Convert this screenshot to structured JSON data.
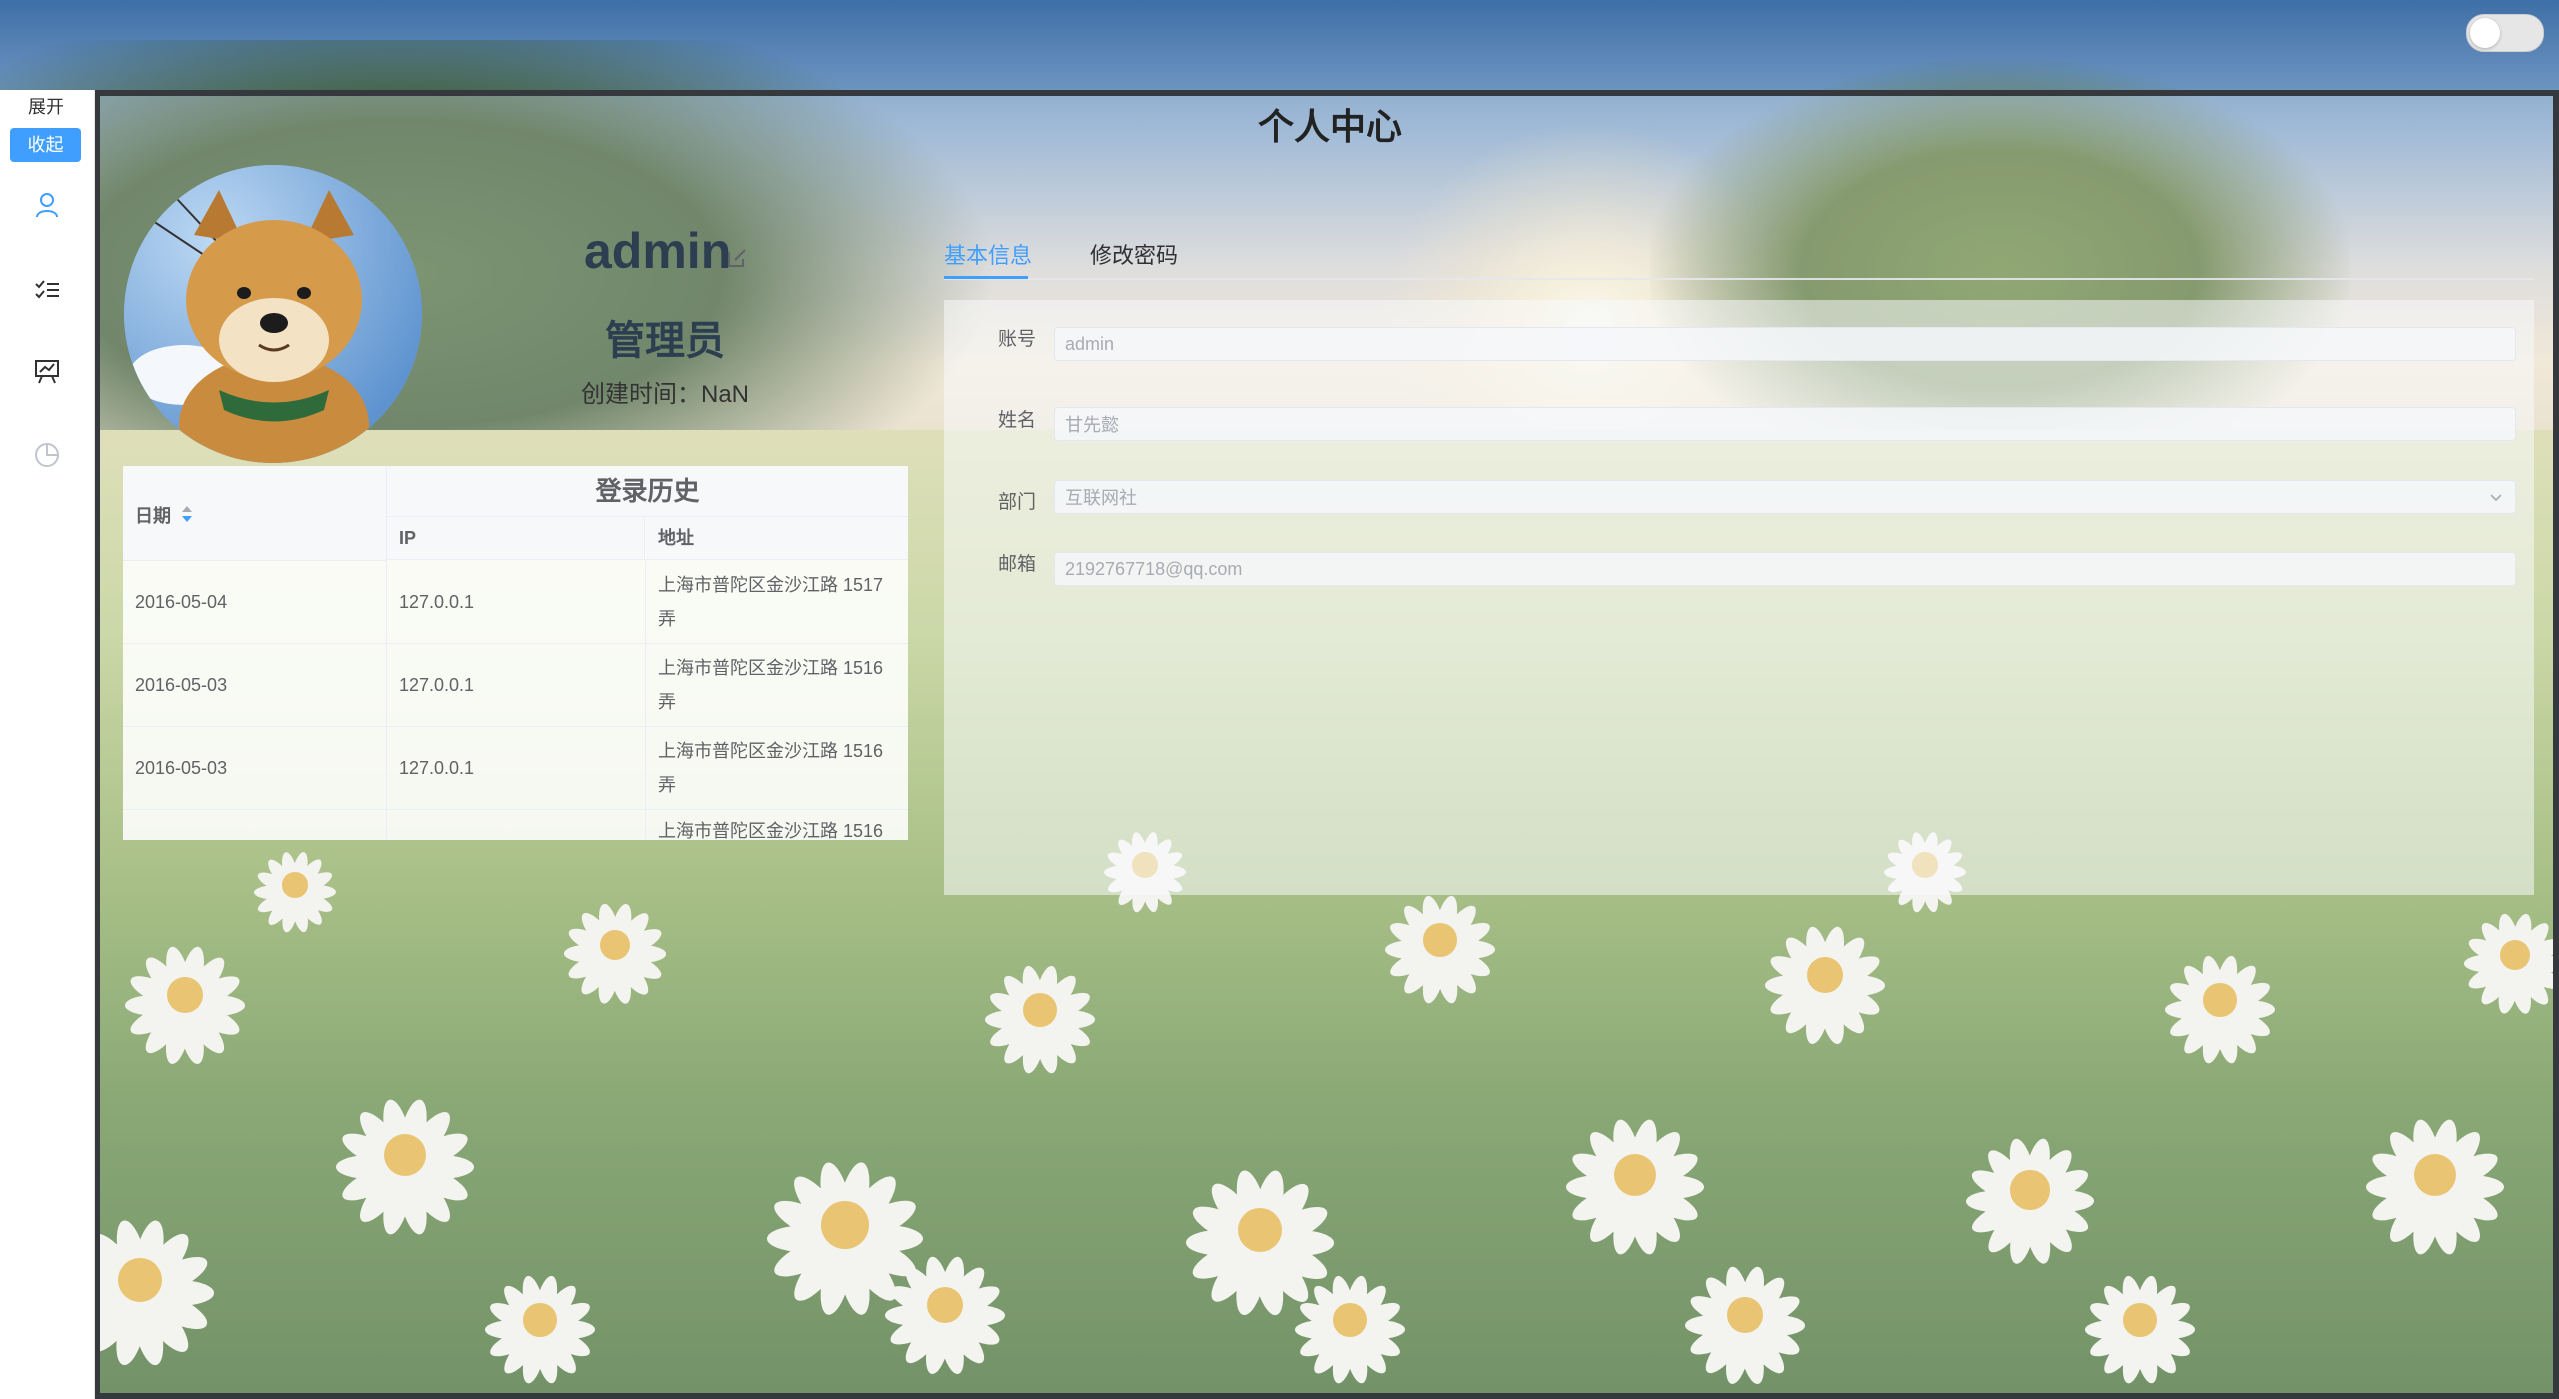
{
  "sidebar": {
    "expand_label": "展开",
    "collapse_label": "收起",
    "nav": [
      "user-icon",
      "task-list-icon",
      "presentation-chart-icon",
      "pie-chart-icon"
    ]
  },
  "header": {
    "title": "个人中心",
    "theme_toggle": "off"
  },
  "profile": {
    "username": "admin",
    "role": "管理员",
    "created_label": "创建时间：",
    "created_value": "NaN"
  },
  "login_history": {
    "title": "登录历史",
    "columns": {
      "date": "日期",
      "ip": "IP",
      "address": "地址"
    },
    "rows": [
      {
        "date": "2016-05-04",
        "ip": "127.0.0.1",
        "address": "上海市普陀区金沙江路 1517 弄"
      },
      {
        "date": "2016-05-03",
        "ip": "127.0.0.1",
        "address": "上海市普陀区金沙江路 1516 弄"
      },
      {
        "date": "2016-05-03",
        "ip": "127.0.0.1",
        "address": "上海市普陀区金沙江路 1516 弄"
      },
      {
        "date": "",
        "ip": "",
        "address": "上海市普陀区金沙江路 1516"
      }
    ]
  },
  "tabs": [
    {
      "label": "基本信息",
      "active": true
    },
    {
      "label": "修改密码",
      "active": false
    }
  ],
  "form": {
    "account": {
      "label": "账号",
      "value": "admin"
    },
    "name": {
      "label": "姓名",
      "value": "甘先懿"
    },
    "department": {
      "label": "部门",
      "value": "互联网社"
    },
    "email": {
      "label": "邮箱",
      "value": "2192767718@qq.com"
    }
  },
  "colors": {
    "accent": "#409eff",
    "frame": "#35383d",
    "text": "#606266"
  }
}
